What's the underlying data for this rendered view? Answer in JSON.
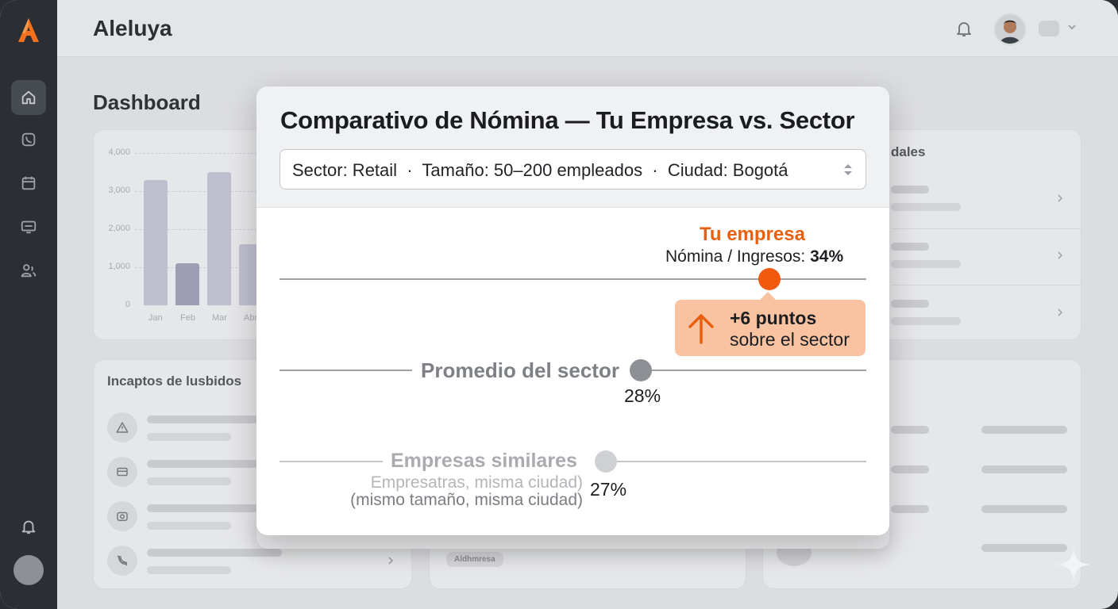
{
  "app": {
    "title": "Aleluya",
    "page_title": "Dashboard"
  },
  "sidebar": {
    "items": [
      {
        "icon": "home-icon",
        "active": true
      },
      {
        "icon": "phone-icon",
        "active": false
      },
      {
        "icon": "calendar-icon",
        "active": false
      },
      {
        "icon": "monitor-icon",
        "active": false
      },
      {
        "icon": "users-icon",
        "active": false
      }
    ],
    "bottom": [
      "bell-icon",
      "avatar"
    ]
  },
  "background": {
    "chart_card": {
      "y_ticks": [
        "4,000",
        "3,000",
        "2,000",
        "1,000",
        "0"
      ],
      "x_ticks": [
        "Jan",
        "Feb",
        "Mar",
        "Abr"
      ]
    },
    "right_card_title": "dales",
    "incidents_card_title": "Incaptos de lusbidos",
    "middle_tag": "Aldhmresa"
  },
  "chart_data": {
    "type": "bar",
    "categories": [
      "Jan",
      "Feb",
      "Mar",
      "Abr"
    ],
    "values": [
      3300,
      1100,
      3500,
      1600
    ],
    "ylim": [
      0,
      4000
    ],
    "yticks": [
      0,
      1000,
      2000,
      3000,
      4000
    ]
  },
  "modal": {
    "title": "Comparativo de Nómina — Tu Empresa vs. Sector",
    "filter": "Sector: Retail  ·  Tamaño: 50–200 empleados  ·  Ciudad: Bogotá",
    "company": {
      "label": "Tu empresa",
      "metric_label": "Nómina / Ingresos: ",
      "value": "34%",
      "value_num": 34,
      "color": "#f1590f"
    },
    "callout": {
      "line1": "+6 puntos",
      "line2": "sobre el sector",
      "color": "#f9c3a2"
    },
    "sector": {
      "label": "Promedio del sector",
      "value": "28%",
      "value_num": 28,
      "color": "#8c8f93"
    },
    "similar": {
      "label": "Empresas similares",
      "note_line1": "Empresatras, misma ciudad)",
      "note_line2": "(mismo tamaño, misma ciudad)",
      "value": "27%",
      "value_num": 27,
      "color": "#cfd0d3"
    }
  }
}
